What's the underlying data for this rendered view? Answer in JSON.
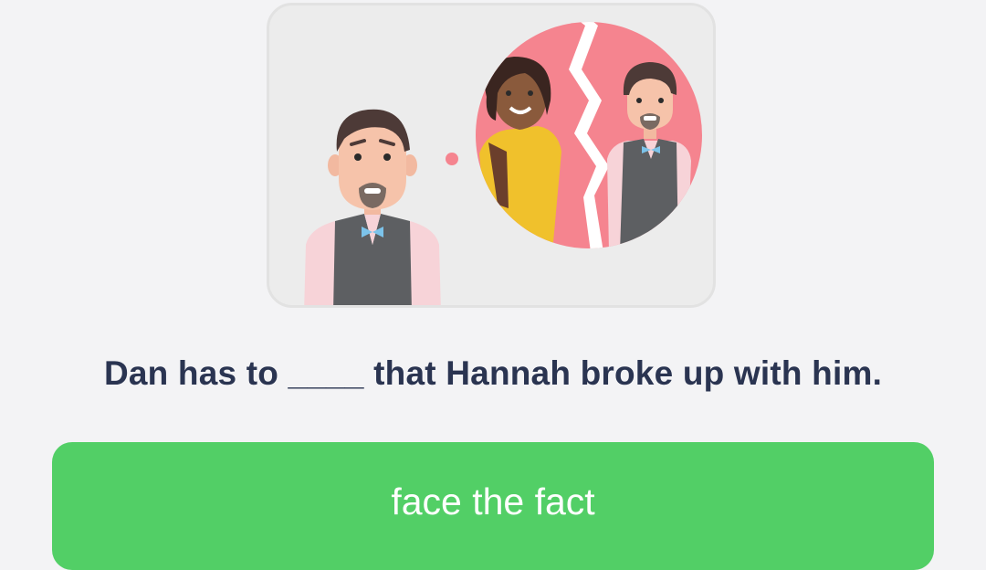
{
  "question": {
    "text": "Dan has to ____ that Hannah broke up with him."
  },
  "answer_option": {
    "label": "face the fact"
  },
  "colors": {
    "background": "#f3f3f5",
    "card_background": "#ececec",
    "thought_bubble": "#f5848f",
    "button": "#52cf66",
    "question_text": "#2a3451",
    "answer_text": "#ffffff"
  },
  "illustration": {
    "icon": "breakup-thought-illustration"
  }
}
